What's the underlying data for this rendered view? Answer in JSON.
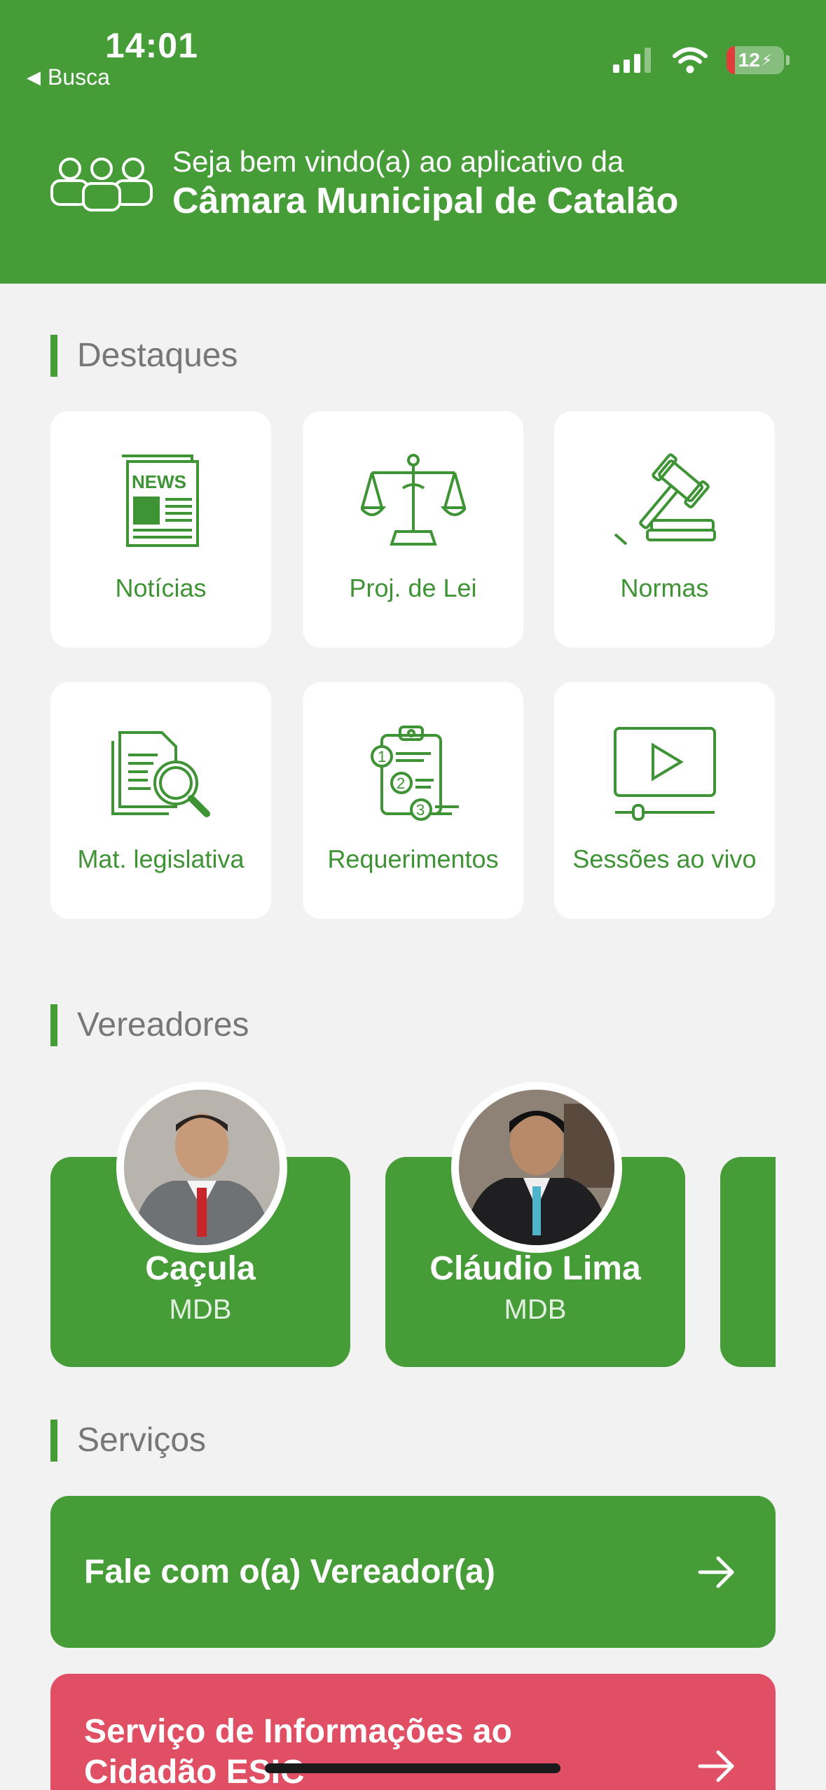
{
  "status": {
    "time": "14:01",
    "back": "Busca",
    "battery": "12"
  },
  "header": {
    "subtitle": "Seja bem vindo(a) ao aplicativo da",
    "title": "Câmara Municipal de Catalão"
  },
  "sections": {
    "highlights": "Destaques",
    "councilors": "Vereadores",
    "services": "Serviços"
  },
  "tiles": [
    {
      "label": "Notícias",
      "icon": "newspaper-icon"
    },
    {
      "label": "Proj. de Lei",
      "icon": "scales-icon"
    },
    {
      "label": "Normas",
      "icon": "gavel-icon"
    },
    {
      "label": "Mat. legislativa",
      "icon": "document-search-icon"
    },
    {
      "label": "Requerimentos",
      "icon": "clipboard-list-icon"
    },
    {
      "label": "Sessões ao vivo",
      "icon": "video-player-icon"
    }
  ],
  "councilors": [
    {
      "name": "Caçula",
      "party": "MDB"
    },
    {
      "name": "Cláudio Lima",
      "party": "MDB"
    }
  ],
  "services": [
    {
      "label": "Fale com o(a) Vereador(a)",
      "color": "#469d38"
    },
    {
      "label_line1": "Serviço de Informações ao",
      "label_line2": "Cidadão ESIC",
      "color": "#e04f63"
    }
  ],
  "colors": {
    "primary": "#469d38",
    "icon": "#3e9334",
    "danger": "#e04f63",
    "background": "#f2f2f2"
  }
}
